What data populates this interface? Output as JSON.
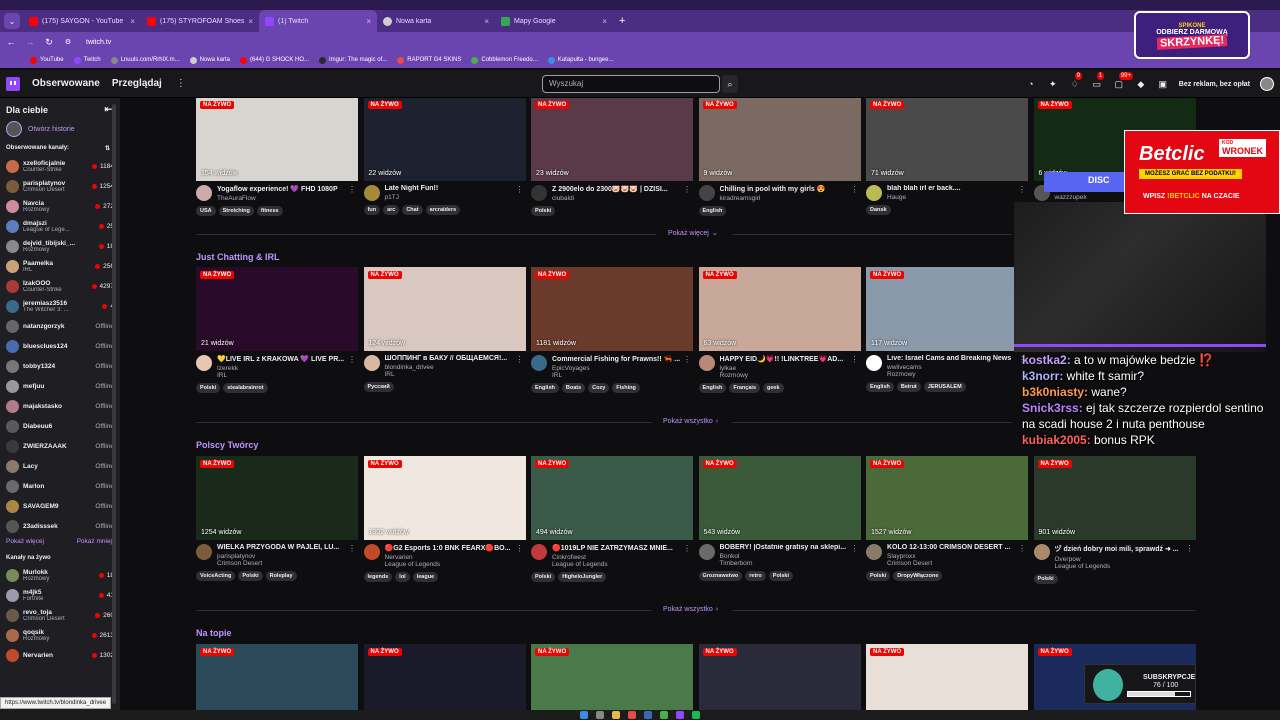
{
  "browser": {
    "tabs": [
      {
        "label": "(175) SAYGON - YouTube",
        "icon": "youtube"
      },
      {
        "label": "(175) STYROFOAM Shoes for S",
        "icon": "youtube"
      },
      {
        "label": "(1) Twitch",
        "icon": "twitch",
        "active": true
      },
      {
        "label": "Nowa karta",
        "icon": "globe"
      },
      {
        "label": "Mapy Google",
        "icon": "maps"
      }
    ],
    "url": "twitch.tv",
    "bookmarks": [
      "YouTube",
      "Twitch",
      "Lnuuls.com/RrhlX.m...",
      "Nowa karta",
      "(644) G SHOCK HO...",
      "Imgur: The magic of...",
      "RAPORT G4 SKINS",
      "Cobblemon Freedo...",
      "Katapulta - bungee..."
    ],
    "promo": {
      "top": "ODBIERZ DARMOWĄ",
      "bottom": "SKRZYNKĘ!",
      "brand": "SPIKONE"
    }
  },
  "header": {
    "following": "Obserwowane",
    "browse": "Przeglądaj",
    "search_placeholder": "Wyszukaj",
    "badges": {
      "notifications": "9",
      "inbox": "1",
      "whispers": "99+"
    },
    "no_ads": "Bez reklam, bez opłat"
  },
  "sidebar": {
    "for_you": "Dla ciebie",
    "history": "Otwórz historie",
    "followed_title": "Obserwowane kanały:",
    "followed": [
      {
        "name": "xzelloficjalnie",
        "game": "Counter-Strike",
        "viewers": "1184",
        "color": "#c76b4a"
      },
      {
        "name": "parisplatynov",
        "game": "Crimson Desert",
        "viewers": "1254",
        "color": "#7a5c3c"
      },
      {
        "name": "Navcia",
        "game": "Rozmowy",
        "viewers": "272",
        "color": "#d08aa0"
      },
      {
        "name": "dmajszi",
        "game": "League of Lege...",
        "viewers": "25",
        "color": "#5a7cc0"
      },
      {
        "name": "dejvid_tibijski_...",
        "game": "Rozmowy",
        "viewers": "18",
        "color": "#8a8a8a"
      },
      {
        "name": "Paamelka",
        "game": "IRL",
        "viewers": "256",
        "color": "#c9a27a"
      },
      {
        "name": "IzakOOO",
        "game": "Counter-Strike",
        "viewers": "4297",
        "color": "#a83a3a"
      },
      {
        "name": "jeremiasz3516",
        "game": "The Witcher 3: ...",
        "viewers": "4",
        "color": "#3a6a8a"
      },
      {
        "name": "natanzgorzyk",
        "offline": "Offline",
        "color": "#666"
      },
      {
        "name": "bluesclues124",
        "offline": "Offline",
        "color": "#4a6ab0"
      },
      {
        "name": "tobby1324",
        "offline": "Offline",
        "color": "#777"
      },
      {
        "name": "mefjuu",
        "offline": "Offline",
        "color": "#999"
      },
      {
        "name": "majakstasko",
        "offline": "Offline",
        "color": "#b07a8a"
      },
      {
        "name": "Diabeuu6",
        "offline": "Offline",
        "color": "#5a5a5a"
      },
      {
        "name": "ZWIERZAAAK",
        "offline": "Offline",
        "color": "#3a3a3a"
      },
      {
        "name": "Lacy",
        "offline": "Offline",
        "color": "#8a7a6a"
      },
      {
        "name": "Marlon",
        "offline": "Offline",
        "color": "#6a6a6a"
      },
      {
        "name": "SAVAGEM9",
        "offline": "Offline",
        "color": "#aa8844"
      },
      {
        "name": "23adisssek",
        "offline": "Offline",
        "color": "#555"
      }
    ],
    "show_more": "Pokaż więcej",
    "show_less": "Pokaż mniej",
    "live_title": "Kanały na żywo",
    "live": [
      {
        "name": "Murlokk",
        "game": "Rozmowy",
        "viewers": "18",
        "color": "#7a8a5a"
      },
      {
        "name": "m4jk5",
        "game": "Fortnite",
        "viewers": "41",
        "color": "#9a9aaa"
      },
      {
        "name": "revo_toja",
        "game": "Crimson Desert",
        "viewers": "260",
        "color": "#6a5a4a"
      },
      {
        "name": "qoqsik",
        "game": "Rozmowy",
        "viewers": "2613",
        "color": "#aa6a4a"
      },
      {
        "name": "Nervarien",
        "game": "",
        "viewers": "1302",
        "color": "#c04a2a"
      }
    ]
  },
  "main": {
    "live_label": "NA ŻYWO",
    "row1": [
      {
        "viewers": "154 widzów",
        "title": "Yogaflow experience! 💜 FHD 1080P",
        "channel": "TheAuraFlow",
        "tags": [
          "USA",
          "Stretching",
          "fitness"
        ],
        "thumb": "#d8d4cf",
        "av": "#caa"
      },
      {
        "viewers": "22 widzów",
        "title": "Late Night Fun!!",
        "channel": "p1TJ",
        "tags": [
          "fun",
          "arc",
          "Chat",
          "arcraiders"
        ],
        "thumb": "#1d2230",
        "av": "#a58a3a"
      },
      {
        "viewers": "23 widzów",
        "title": "Z 2900elo do 2300🐷🐷🐷 | DZISI...",
        "channel": "ciubaldi",
        "tags": [
          "Polski"
        ],
        "thumb": "#5a3a48",
        "av": "#333"
      },
      {
        "viewers": "9 widzów",
        "title": "Chilling in pool with my girls 😍",
        "channel": "kiradreamsgirl",
        "tags": [
          "English"
        ],
        "thumb": "#7a6a62",
        "av": "#444"
      },
      {
        "viewers": "71 widzów",
        "title": "blah blah irl er back....",
        "channel": "Hauge",
        "tags": [
          "Dansk"
        ],
        "thumb": "#4a4a4a",
        "av": "#bb5"
      },
      {
        "viewers": "6 widzów",
        "title": "12H streamek tak czy siak",
        "channel": "wazzzupek",
        "tags": [],
        "thumb": "#142a14",
        "av": "#555"
      }
    ],
    "show_more_1": "Pokaż więcej",
    "section2": "Just Chatting & IRL",
    "row2": [
      {
        "viewers": "21 widzów",
        "title": "💛LIVE IRL z KRAKOWA 💜 LIVE PR...",
        "channel": "Izerekk",
        "category": "IRL",
        "tags": [
          "Polski",
          "stealabrainrot"
        ],
        "thumb": "#2a0a2a",
        "av": "#e8c7b0"
      },
      {
        "viewers": "124 widzów",
        "title": "ШОППИНГ в БАКУ // ОБЩАЕМСЯ!...",
        "channel": "blondinka_drivee",
        "category": "IRL",
        "tags": [
          "Русский"
        ],
        "thumb": "#d8c8c0",
        "av": "#d8b8a0"
      },
      {
        "viewers": "1181 widzów",
        "title": "Commercial Fishing for Prawns!! 🦐 ...",
        "channel": "EpicVoyages",
        "category": "IRL",
        "tags": [
          "English",
          "Boats",
          "Cozy",
          "Fishing"
        ],
        "thumb": "#6a3a2a",
        "av": "#3a6a8a"
      },
      {
        "viewers": "63 widzów",
        "title": "HAPPY EID🌙💗!! !LINKTREE💗AD...",
        "channel": "lylkae",
        "category": "Rozmowy",
        "tags": [
          "English",
          "Français",
          "geek"
        ],
        "thumb": "#c8a898",
        "av": "#b88878"
      },
      {
        "viewers": "117 widzów",
        "title": "Live: Israel Cams and Breaking News",
        "channel": "wwlivecams",
        "category": "Rozmowy",
        "tags": [
          "English",
          "Beirut",
          "JERUSALEM"
        ],
        "thumb": "#8a9aaa",
        "av": "#fff"
      }
    ],
    "show_all_2": "Pokaż wszystko",
    "section3": "Polscy Twórcy",
    "row3": [
      {
        "viewers": "1254 widzów",
        "title": "WIELKA PRZYGODA W PAJLEI, LU...",
        "channel": "parisplatynov",
        "category": "Crimson Desert",
        "tags": [
          "VoiceActing",
          "Polski",
          "Roleplay"
        ],
        "thumb": "#1a2a1a",
        "av": "#7a5c3c"
      },
      {
        "viewers": "1302 widzów",
        "title": "🔴G2 Esports 1:0 BNK FEARX🔴BO...",
        "channel": "Nervarien",
        "category": "League of Legends",
        "tags": [
          "legends",
          "lol",
          "league"
        ],
        "thumb": "#f0e8e0",
        "av": "#c04a2a"
      },
      {
        "viewers": "494 widzów",
        "title": "🔴1019LP NIE ZATRZYMASZ MNIE...",
        "channel": "Cinkrofwest",
        "category": "League of Legends",
        "tags": [
          "Polski",
          "HigheloJungler"
        ],
        "thumb": "#3a5a4a",
        "av": "#c03a3a"
      },
      {
        "viewers": "543 widzów",
        "title": "BOBERY! |Ostatnie gratisy na sklepi...",
        "channel": "Bonkol",
        "category": "Timberborn",
        "tags": [
          "Groznawstwo",
          "retro",
          "Polski"
        ],
        "thumb": "#3a5a3a",
        "av": "#6a6a6a"
      },
      {
        "viewers": "1527 widzów",
        "title": "KOLO 12-13:00 CRIMSON DESERT ...",
        "channel": "Slayproxx",
        "category": "Crimson Desert",
        "tags": [
          "Polski",
          "DropyWłączone"
        ],
        "thumb": "#4a6a3a",
        "av": "#8a7a6a"
      },
      {
        "viewers": "901 widzów",
        "title": "ヅ dzień dobry moi mili, sprawdź ➜ ...",
        "channel": "Overpow",
        "category": "League of Legends",
        "tags": [
          "Polski"
        ],
        "thumb": "#2a3a2a",
        "av": "#aa8a6a"
      }
    ],
    "show_all_3": "Pokaż wszystko",
    "section4": "Na topie",
    "row4": [
      {
        "thumb": "#2a4a5a"
      },
      {
        "thumb": "#1a1a2a"
      },
      {
        "thumb": "#4a7a4a"
      },
      {
        "thumb": "#2a2a3a"
      },
      {
        "thumb": "#e8e0d8"
      },
      {
        "thumb": "#1a2a5a"
      }
    ]
  },
  "overlay": {
    "discord": "DISC",
    "betclic": {
      "brand": "Betclic",
      "code_label": "KOD",
      "code": "WRONEK",
      "line1": "MOŻESZ GRAĆ BEZ PODATKU!",
      "line2_pre": "WPISZ",
      "line2_code": "!BETCLIC",
      "line2_post": "NA CZACIE"
    },
    "chat": [
      {
        "user": "kostka2:",
        "text": " a to w majówke bedzie ⁉️",
        "color": "#c8a0ff"
      },
      {
        "user": "k3norr:",
        "text": " white ft samir?",
        "color": "#b0b0ff"
      },
      {
        "user": "b3k0niasty:",
        "text": " wane?",
        "color": "#ff9a4a"
      },
      {
        "user": "Snick3rss:",
        "text": " ej tak szczerze rozpierdol sentino na scadi house 2 i nuta penthouse",
        "color": "#c080ff"
      },
      {
        "user": "kubiak2005:",
        "text": " bonus RPK",
        "color": "#ff6060"
      }
    ],
    "sub": {
      "label": "SUBSKRYPCJE",
      "count": "76 / 100",
      "progress": 0.76
    }
  },
  "status_url": "https://www.twitch.tv/blondinka_drivee"
}
